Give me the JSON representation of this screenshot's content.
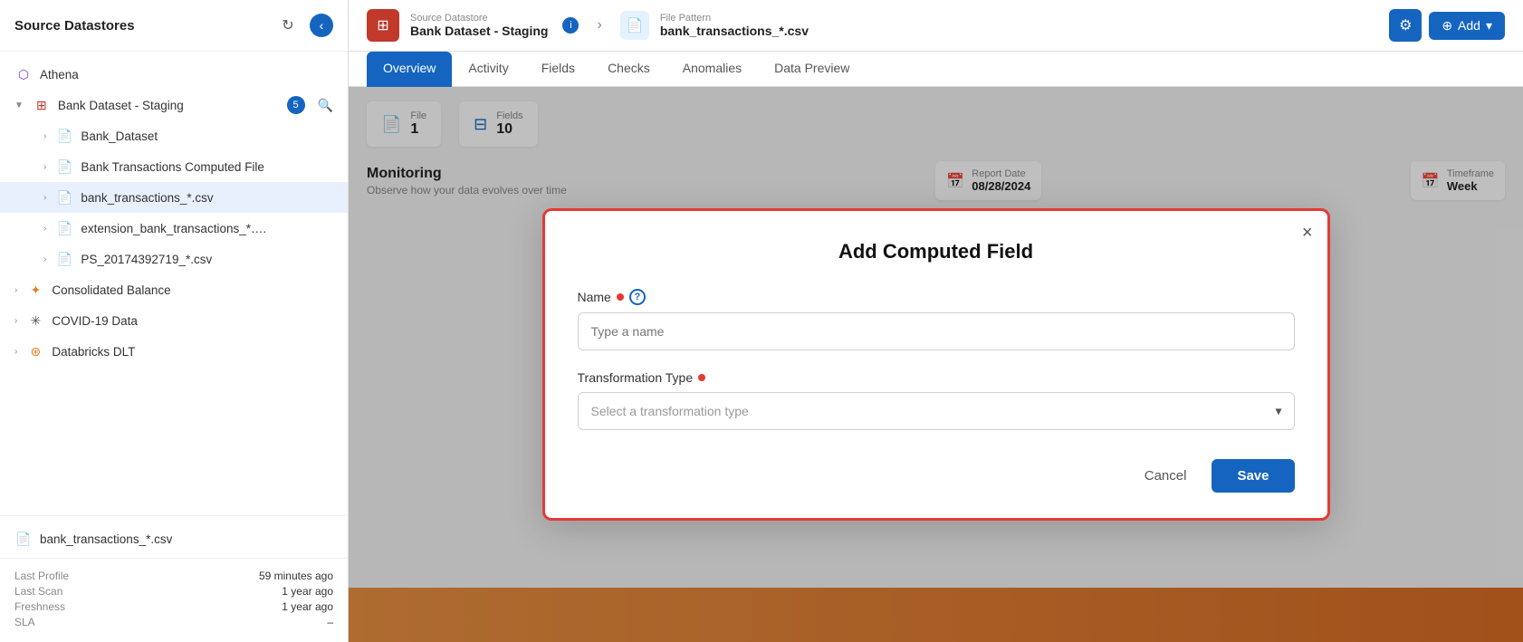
{
  "sidebar": {
    "title": "Source Datastores",
    "items": [
      {
        "id": "athena",
        "label": "Athena",
        "icon": "purple-circle",
        "iconColor": "purple",
        "level": 0
      },
      {
        "id": "bank-dataset-staging",
        "label": "Bank Dataset - Staging",
        "icon": "red-grid",
        "iconColor": "red",
        "level": 0,
        "badge": "5",
        "hasSearch": true,
        "expanded": true
      },
      {
        "id": "bank-dataset",
        "label": "Bank_Dataset",
        "icon": "file",
        "iconColor": "dark",
        "level": 1
      },
      {
        "id": "bank-transactions-computed",
        "label": "Bank Transactions Computed File",
        "icon": "file",
        "iconColor": "dark",
        "level": 1
      },
      {
        "id": "bank-transactions-csv",
        "label": "bank_transactions_*.csv",
        "icon": "file-blue",
        "iconColor": "blue",
        "level": 1,
        "active": true
      },
      {
        "id": "extension-bank",
        "label": "extension_bank_transactions_*....",
        "icon": "file",
        "iconColor": "dark",
        "level": 1
      },
      {
        "id": "ps-file",
        "label": "PS_20174392719_*.csv",
        "icon": "file",
        "iconColor": "dark",
        "level": 1
      },
      {
        "id": "consolidated-balance",
        "label": "Consolidated Balance",
        "icon": "star",
        "iconColor": "orange",
        "level": 0
      },
      {
        "id": "covid-data",
        "label": "COVID-19 Data",
        "icon": "snowflake",
        "iconColor": "dark",
        "level": 0
      },
      {
        "id": "databricks-dlt",
        "label": "Databricks DLT",
        "icon": "layers",
        "iconColor": "orange",
        "level": 0
      }
    ],
    "bottom_item": {
      "label": "bank_transactions_*.csv",
      "icon": "file-blue"
    },
    "footer": {
      "last_profile_label": "Last Profile",
      "last_profile_value": "59 minutes ago",
      "last_scan_label": "Last Scan",
      "last_scan_value": "1 year ago",
      "freshness_label": "Freshness",
      "freshness_value": "1 year ago",
      "sla_label": "SLA",
      "sla_value": "–"
    }
  },
  "topbar": {
    "source_label": "Source Datastore",
    "source_value": "Bank Dataset - Staging",
    "file_pattern_label": "File Pattern",
    "file_pattern_value": "bank_transactions_*.csv",
    "settings_icon": "gear",
    "add_label": "Add"
  },
  "tabs": [
    {
      "id": "overview",
      "label": "Overview",
      "active": true
    },
    {
      "id": "activity",
      "label": "Activity",
      "active": false
    },
    {
      "id": "fields",
      "label": "Fields",
      "active": false
    },
    {
      "id": "checks",
      "label": "Checks",
      "active": false
    },
    {
      "id": "anomalies",
      "label": "Anomalies",
      "active": false
    },
    {
      "id": "data-preview",
      "label": "Data Preview",
      "active": false
    }
  ],
  "stats": {
    "file_label": "File",
    "file_value": "1",
    "fields_label": "Fields",
    "fields_value": "10"
  },
  "monitoring": {
    "title": "Monitoring",
    "subtitle": "Observe how your data evolves over time",
    "report_date_label": "Report Date",
    "report_date_value": "08/28/2024",
    "timeframe_label": "Timeframe",
    "timeframe_value": "Week"
  },
  "modal": {
    "title": "Add Computed Field",
    "close_icon": "×",
    "name_label": "Name",
    "name_placeholder": "Type a name",
    "transformation_label": "Transformation Type",
    "transformation_placeholder": "Select a transformation type",
    "cancel_label": "Cancel",
    "save_label": "Save"
  }
}
